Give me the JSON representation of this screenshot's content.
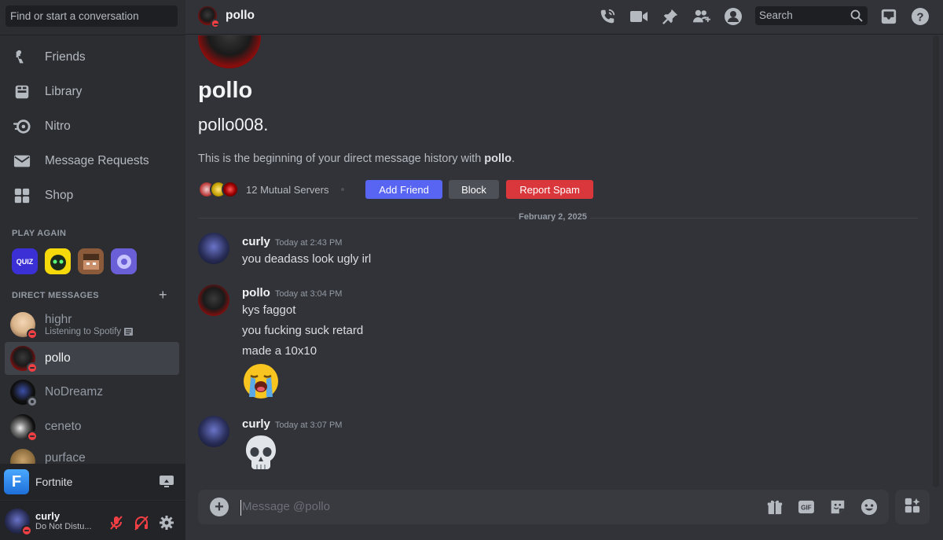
{
  "sidebar": {
    "search_placeholder": "Find or start a conversation",
    "nav": [
      {
        "label": "Friends",
        "icon": "friends-icon"
      },
      {
        "label": "Library",
        "icon": "library-icon"
      },
      {
        "label": "Nitro",
        "icon": "nitro-icon"
      },
      {
        "label": "Message Requests",
        "icon": "envelope-icon"
      },
      {
        "label": "Shop",
        "icon": "shop-icon"
      }
    ],
    "play_again_header": "PLAY AGAIN",
    "games": [
      {
        "label": "QUIZ",
        "color": "#3b2fd6"
      },
      {
        "label": "",
        "color": "#f5d90a"
      },
      {
        "label": "",
        "color": "#8a5a3b"
      },
      {
        "label": "",
        "color": "#6b5fd8"
      }
    ],
    "dm_header": "DIRECT MESSAGES",
    "dms": [
      {
        "name": "highr",
        "sub": "Listening to Spotify",
        "status": "dnd"
      },
      {
        "name": "pollo",
        "sub": "",
        "status": "dnd",
        "active": true
      },
      {
        "name": "NoDreamz",
        "sub": "",
        "status": "offline"
      },
      {
        "name": "ceneto",
        "sub": "",
        "status": "dnd"
      },
      {
        "name": "purface",
        "sub": "",
        "status": "dnd"
      }
    ]
  },
  "game_bar": {
    "label": "Fortnite",
    "icon_letter": "F"
  },
  "user_panel": {
    "name": "curly",
    "status": "Do Not Distu..."
  },
  "header": {
    "title": "pollo",
    "search_placeholder": "Search"
  },
  "profile": {
    "display_name": "pollo",
    "username": "pollo008.",
    "intro_prefix": "This is the beginning of your direct message history with ",
    "intro_name": "pollo",
    "intro_suffix": ".",
    "mutual_servers": "12 Mutual Servers",
    "add_friend": "Add Friend",
    "block": "Block",
    "report_spam": "Report Spam"
  },
  "date_divider": "February 2, 2025",
  "messages": [
    {
      "author": "curly",
      "time": "Today at 2:43 PM",
      "lines": [
        "you deadass look ugly irl"
      ]
    },
    {
      "author": "pollo",
      "time": "Today at 3:04 PM",
      "lines": [
        "kys faggot",
        "you fucking suck retard",
        "made a 10x10"
      ],
      "emoji": "loudly-crying-face"
    },
    {
      "author": "curly",
      "time": "Today at 3:07 PM",
      "lines": [],
      "emoji": "skull"
    }
  ],
  "composer": {
    "placeholder": "Message @pollo",
    "gif_label": "GIF"
  },
  "colors": {
    "blurple": "#5865f2",
    "danger": "#da373c",
    "dnd": "#f23f43"
  }
}
